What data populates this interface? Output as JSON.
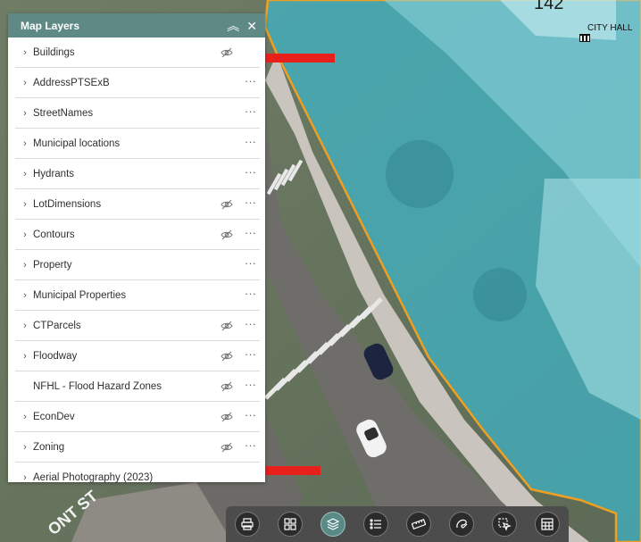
{
  "panel": {
    "title": "Map Layers",
    "header_color": "#5f8985",
    "layers": [
      {
        "name": "Buildings",
        "expandable": true,
        "visibility_toggle": true,
        "more_menu": false
      },
      {
        "name": "AddressPTSExB",
        "expandable": true,
        "visibility_toggle": false,
        "more_menu": true
      },
      {
        "name": "StreetNames",
        "expandable": true,
        "visibility_toggle": false,
        "more_menu": true
      },
      {
        "name": "Municipal locations",
        "expandable": true,
        "visibility_toggle": false,
        "more_menu": true
      },
      {
        "name": "Hydrants",
        "expandable": true,
        "visibility_toggle": false,
        "more_menu": true
      },
      {
        "name": "LotDimensions",
        "expandable": true,
        "visibility_toggle": true,
        "more_menu": true
      },
      {
        "name": "Contours",
        "expandable": true,
        "visibility_toggle": true,
        "more_menu": true
      },
      {
        "name": "Property",
        "expandable": true,
        "visibility_toggle": false,
        "more_menu": true
      },
      {
        "name": "Municipal Properties",
        "expandable": true,
        "visibility_toggle": false,
        "more_menu": true
      },
      {
        "name": "CTParcels",
        "expandable": true,
        "visibility_toggle": true,
        "more_menu": true
      },
      {
        "name": "Floodway",
        "expandable": true,
        "visibility_toggle": true,
        "more_menu": true
      },
      {
        "name": "NFHL - Flood Hazard Zones",
        "expandable": false,
        "visibility_toggle": true,
        "more_menu": true
      },
      {
        "name": "EconDev",
        "expandable": true,
        "visibility_toggle": true,
        "more_menu": true
      },
      {
        "name": "Zoning",
        "expandable": true,
        "visibility_toggle": true,
        "more_menu": true
      },
      {
        "name": "Aerial Photography (2023)",
        "expandable": true,
        "visibility_toggle": false,
        "more_menu": false
      }
    ]
  },
  "map": {
    "label_city_hall": "CITY HALL",
    "label_number": "142",
    "label_street": "ONT ST",
    "parcel_fill": "#3fb6c7",
    "parcel_outline": "#f0a020"
  },
  "toolbar": {
    "tools": [
      {
        "icon": "print-icon"
      },
      {
        "icon": "basemap-gallery-icon"
      },
      {
        "icon": "layers-icon",
        "active": true
      },
      {
        "icon": "legend-icon"
      },
      {
        "icon": "measure-icon"
      },
      {
        "icon": "sketch-icon"
      },
      {
        "icon": "select-icon"
      },
      {
        "icon": "table-icon"
      }
    ]
  },
  "annotations": {
    "arrow_color": "#e8201c"
  }
}
